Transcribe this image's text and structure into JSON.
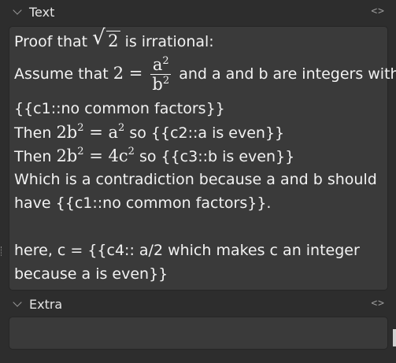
{
  "fields": [
    {
      "label": "Text",
      "toggle_icon": "<>"
    },
    {
      "label": "Extra",
      "toggle_icon": "<>"
    }
  ],
  "text_field": {
    "line1_a": "Proof that",
    "line1_sqrt": "2",
    "line1_b": "is irrational:",
    "line2_a": "Assume that",
    "line2_lhs": "2 =",
    "line2_num": "a",
    "line2_num_exp": "2",
    "line2_den": "b",
    "line2_den_exp": "2",
    "line2_b": "and a and b are integers with",
    "line3": "{{c1::no common factors}}",
    "line4_a": "Then",
    "line4_math_a": "2b",
    "line4_math_a_exp": "2",
    "line4_math_b": " = a",
    "line4_math_b_exp": "2",
    "line4_b": "so {{c2::a is even}}",
    "line5_a": "Then",
    "line5_math_a": "2b",
    "line5_math_a_exp": "2",
    "line5_math_b": " = 4c",
    "line5_math_b_exp": "2",
    "line5_b": "so {{c3::b is even}}",
    "line6": "Which is a contradiction because a and b should",
    "line7": "have {{c1::no common factors}}.",
    "line8": "here, c = {{c4:: a/2 which makes c an integer",
    "line9": "because a is even}}"
  },
  "extra_field": {
    "value": ""
  }
}
